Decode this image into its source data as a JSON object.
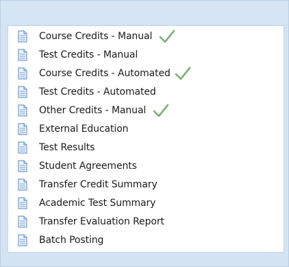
{
  "menu": {
    "items": [
      {
        "label": "Course Credits - Manual",
        "checked": true
      },
      {
        "label": "Test Credits - Manual",
        "checked": false
      },
      {
        "label": "Course Credits - Automated",
        "checked": true
      },
      {
        "label": "Test Credits - Automated",
        "checked": false
      },
      {
        "label": "Other Credits - Manual",
        "checked": true
      },
      {
        "label": "External Education",
        "checked": false
      },
      {
        "label": "Test Results",
        "checked": false
      },
      {
        "label": "Student Agreements",
        "checked": false
      },
      {
        "label": "Transfer Credit Summary",
        "checked": false
      },
      {
        "label": "Academic Test Summary",
        "checked": false
      },
      {
        "label": "Transfer Evaluation Report",
        "checked": false
      },
      {
        "label": "Batch Posting",
        "checked": false
      }
    ]
  },
  "colors": {
    "panel_bg": "#d3e3f2",
    "icon_blue": "#4f86c6",
    "check_green": "#7fb07a"
  },
  "icons": {
    "item_icon": "document-icon",
    "status_icon": "checkmark-icon"
  }
}
